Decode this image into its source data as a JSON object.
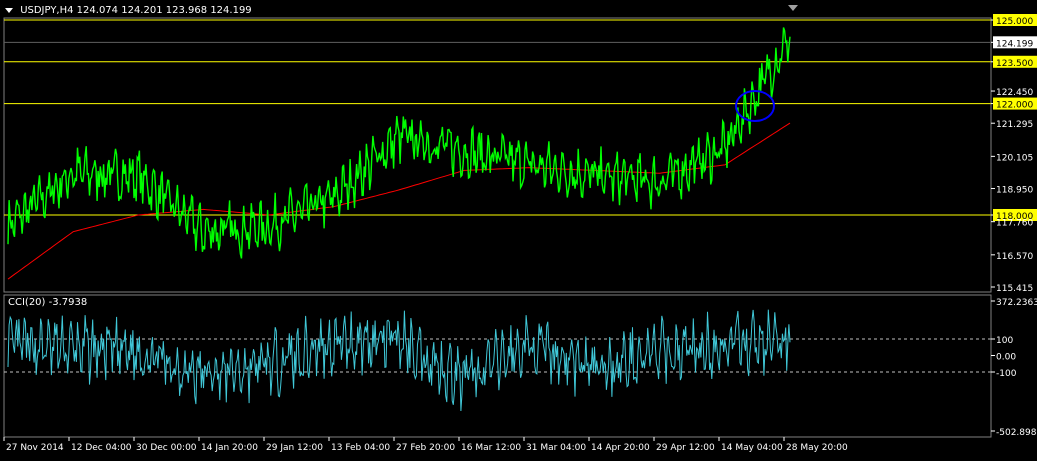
{
  "header": {
    "symbol": "USDJPY,H4",
    "open": "124.074",
    "high": "124.201",
    "low": "123.968",
    "close": "124.199"
  },
  "cci_header": {
    "name": "CCI(20)",
    "value": "-3.7938"
  },
  "colors": {
    "price": "#00ff00",
    "ma": "#ff0000",
    "cci": "#40c8d8",
    "hline": "#ffff00",
    "hline_label_bg": "#ffff00",
    "current_label_bg": "#ffffff",
    "circle": "#0000ff",
    "grid": "#808080"
  },
  "price_axis": {
    "ticks": [
      "125.000",
      "124.199",
      "123.500",
      "122.450",
      "122.000",
      "121.295",
      "120.105",
      "118.950",
      "118.000",
      "117.760",
      "116.570",
      "115.415"
    ]
  },
  "cci_axis": {
    "ticks": [
      "372.2363",
      "100",
      "0.00",
      "-100",
      "-502.8983"
    ]
  },
  "time_axis": {
    "ticks": [
      "27 Nov 2014",
      "12 Dec 04:00",
      "30 Dec 00:00",
      "14 Jan 20:00",
      "29 Jan 12:00",
      "13 Feb 04:00",
      "27 Feb 20:00",
      "16 Mar 12:00",
      "31 Mar 04:00",
      "14 Apr 20:00",
      "29 Apr 12:00",
      "14 May 04:00",
      "28 May 20:00"
    ]
  },
  "chart_data": [
    {
      "type": "line",
      "symbol": "USDJPY,H4",
      "ylim": [
        115.415,
        125.2
      ],
      "horizontal_levels": [
        125.0,
        123.5,
        122.0,
        118.0
      ],
      "current_price": 124.199,
      "series": [
        {
          "name": "price",
          "x": [
            "27 Nov 2014",
            "12 Dec 04:00",
            "30 Dec 00:00",
            "14 Jan 20:00",
            "29 Jan 12:00",
            "13 Feb 04:00",
            "27 Feb 20:00",
            "16 Mar 12:00",
            "31 Mar 04:00",
            "14 Apr 20:00",
            "29 Apr 12:00",
            "14 May 04:00",
            "28 May 20:00"
          ],
          "values": [
            117.6,
            119.5,
            119.4,
            117.4,
            117.6,
            118.6,
            120.8,
            120.3,
            119.8,
            119.4,
            119.2,
            120.4,
            124.4
          ]
        },
        {
          "name": "moving-average",
          "x": [
            "27 Nov 2014",
            "12 Dec 04:00",
            "30 Dec 00:00",
            "14 Jan 20:00",
            "29 Jan 12:00",
            "13 Feb 04:00",
            "27 Feb 20:00",
            "16 Mar 12:00",
            "31 Mar 04:00",
            "14 Apr 20:00",
            "29 Apr 12:00",
            "14 May 04:00",
            "28 May 20:00"
          ],
          "values": [
            115.7,
            117.4,
            118.0,
            118.2,
            118.0,
            118.3,
            118.9,
            119.6,
            119.7,
            119.6,
            119.5,
            119.8,
            121.3
          ]
        }
      ]
    },
    {
      "type": "line",
      "name": "CCI(20)",
      "ylim": [
        -502.8983,
        372.2363
      ],
      "levels": [
        100,
        -100
      ],
      "series": [
        {
          "name": "CCI(20)",
          "x": [
            "27 Nov 2014",
            "12 Dec 04:00",
            "30 Dec 00:00",
            "14 Jan 20:00",
            "29 Jan 12:00",
            "13 Feb 04:00",
            "27 Feb 20:00",
            "16 Mar 12:00",
            "31 Mar 04:00",
            "14 Apr 20:00",
            "29 Apr 12:00",
            "14 May 04:00",
            "28 May 20:00"
          ],
          "values": [
            60,
            40,
            20,
            -120,
            -60,
            80,
            90,
            -150,
            60,
            -80,
            20,
            60,
            80
          ]
        }
      ]
    }
  ]
}
